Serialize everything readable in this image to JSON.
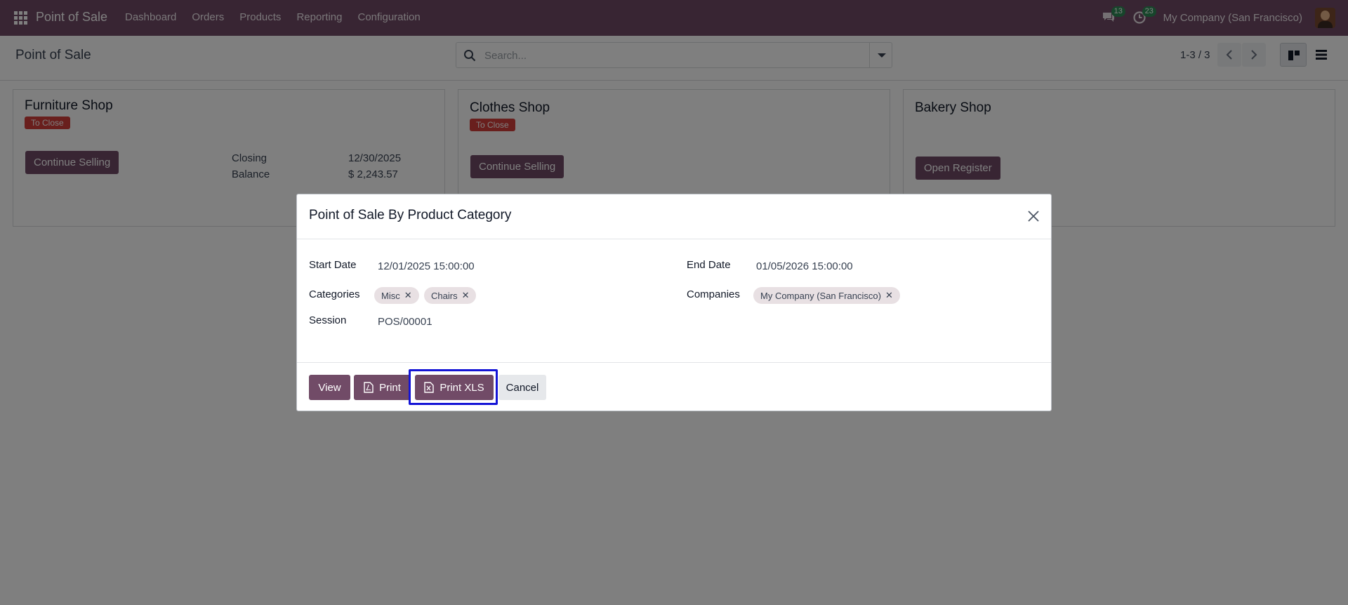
{
  "nav": {
    "app_title": "Point of Sale",
    "menu": [
      "Dashboard",
      "Orders",
      "Products",
      "Reporting",
      "Configuration"
    ],
    "messages_count": "13",
    "activities_count": "23",
    "company": "My Company (San Francisco)"
  },
  "control": {
    "title": "Point of Sale",
    "search_placeholder": "Search...",
    "pager": "1-3 / 3"
  },
  "cards": {
    "furniture": {
      "title": "Furniture Shop",
      "badge": "To Close",
      "button": "Continue Selling",
      "closing_label": "Closing",
      "closing_value": "12/30/2025",
      "balance_label": "Balance",
      "balance_value": "$ 2,243.57"
    },
    "clothes": {
      "title": "Clothes Shop",
      "badge": "To Close",
      "button": "Continue Selling"
    },
    "bakery": {
      "title": "Bakery Shop",
      "button": "Open Register"
    }
  },
  "modal": {
    "title": "Point of Sale By Product Category",
    "start_date_label": "Start Date",
    "start_date_value": "12/01/2025 15:00:00",
    "end_date_label": "End Date",
    "end_date_value": "01/05/2026 15:00:00",
    "categories_label": "Categories",
    "categories": [
      "Misc",
      "Chairs"
    ],
    "companies_label": "Companies",
    "companies": [
      "My Company (San Francisco)"
    ],
    "session_label": "Session",
    "session_value": "POS/00001",
    "buttons": {
      "view": "View",
      "print": "Print",
      "print_xls": "Print XLS",
      "cancel": "Cancel"
    }
  },
  "colors": {
    "brand": "#714b67",
    "badge": "#d23f3a",
    "highlight": "#1414d6"
  }
}
